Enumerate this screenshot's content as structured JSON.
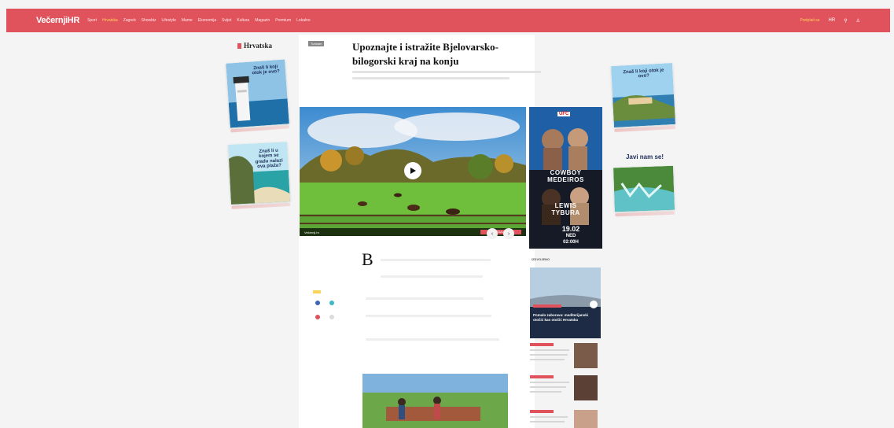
{
  "header": {
    "logo": "VečernjiHR",
    "nav": [
      {
        "label": "Sport",
        "active": false
      },
      {
        "label": "Hrvatska",
        "active": true
      },
      {
        "label": "Zagreb",
        "active": false
      },
      {
        "label": "Showbiz",
        "active": false
      },
      {
        "label": "Lifestyle",
        "active": false
      },
      {
        "label": "Mame",
        "active": false
      },
      {
        "label": "Ekonomija",
        "active": false
      },
      {
        "label": "Svijet",
        "active": false
      },
      {
        "label": "Kultura",
        "active": false
      },
      {
        "label": "Magazin",
        "active": false
      },
      {
        "label": "Premium",
        "active": false
      },
      {
        "label": "Lokalno",
        "active": false
      }
    ],
    "promo": "Pretplati se",
    "lang": "HR",
    "brand_color": "#e0525c",
    "accent_color": "#ffd35a"
  },
  "section": {
    "title": "Hrvatska",
    "icon": "flag-icon"
  },
  "article": {
    "tag": "Turizam",
    "headline": "Upoznajte i istražite Bjelovarsko-bilogorski kraj na konju",
    "dropcap": "B"
  },
  "left_cards": [
    {
      "caption": "Znaš li koji otok je ovo?",
      "icon": "lighthouse-icon"
    },
    {
      "caption": "Znaš li u kojem se gradu nalazi ova plaža?",
      "icon": "beach-icon"
    }
  ],
  "right_cards": [
    {
      "caption": "Znaš li koji otok je ovo?",
      "icon": "island-icon"
    },
    {
      "caption": "Javi nam se!",
      "icon": "waterfall-icon"
    }
  ],
  "video": {
    "label": "Večernji.hr",
    "cta": "POGLEDAJ VIDEO",
    "play_icon": "play-icon"
  },
  "ad": {
    "brand": "UFC",
    "fight1": [
      "COWBOY",
      "MEDEIROS"
    ],
    "fight2": [
      "LEWIS",
      "TYBURA"
    ],
    "date": [
      "19.02",
      "NED",
      "02:00H"
    ]
  },
  "sidebar": {
    "title": "IZDVOJENO",
    "feature_caption": "Pomalo zaborava: mediterijanski otočić kao otočić Hrvatska"
  }
}
